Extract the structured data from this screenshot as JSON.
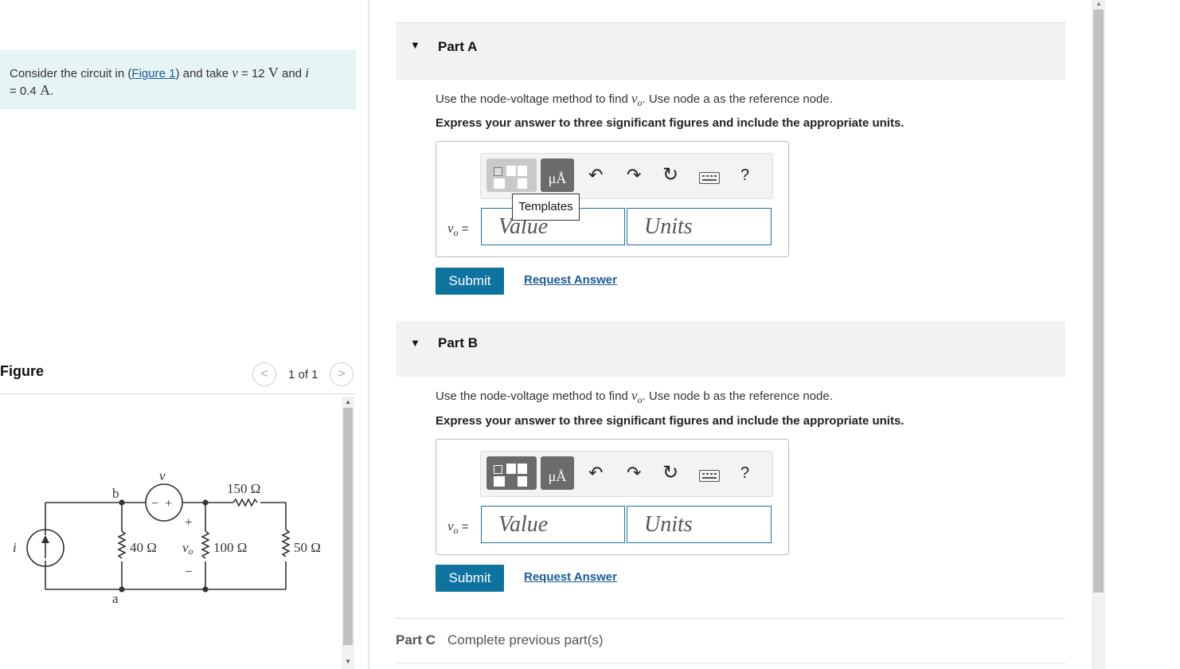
{
  "problem": {
    "prefix": "Consider the circuit in (",
    "figure_link": "Figure 1",
    "mid1": ") and take ",
    "v_sym": "v",
    "eq1": " = 12 ",
    "v_unit": "V",
    "and": " and ",
    "i_sym": "i",
    "eq2": "= 0.4 ",
    "i_unit": "A",
    "end": "."
  },
  "figure": {
    "title": "Figure",
    "prev": "<",
    "counter": "1 of 1",
    "next": ">",
    "circuit": {
      "labels": {
        "b": "b",
        "a": "a",
        "v": "v",
        "i": "i",
        "r40": "40 Ω",
        "r100": "100 Ω",
        "r150": "150 Ω",
        "r50": "50 Ω",
        "vo": "v",
        "vo_sub": "o",
        "plus": "+",
        "minus": "−",
        "src_minus": "−",
        "src_plus": "+"
      }
    }
  },
  "partA": {
    "label": "Part A",
    "question_pre": "Use the node-voltage method to find ",
    "question_var": "v",
    "question_sub": "o",
    "question_post": ". Use node a as the reference node.",
    "instruction": "Express your answer to three significant figures and include the appropriate units.",
    "var_label": "v",
    "var_sub": "o",
    "eq": " =",
    "value_placeholder": "Value",
    "units_placeholder": "Units",
    "tooltip": "Templates",
    "submit": "Submit",
    "request": "Request Answer"
  },
  "partB": {
    "label": "Part B",
    "question_pre": "Use the node-voltage method to find ",
    "question_var": "v",
    "question_sub": "o",
    "question_post": ". Use node b as the reference node.",
    "instruction": "Express your answer to three significant figures and include the appropriate units.",
    "var_label": "v",
    "var_sub": "o",
    "eq": " =",
    "value_placeholder": "Value",
    "units_placeholder": "Units",
    "submit": "Submit",
    "request": "Request Answer"
  },
  "partC": {
    "label": "Part C",
    "status": "Complete previous part(s)"
  },
  "toolbar": {
    "mu_label": "μÅ",
    "undo": "↶",
    "redo": "↷",
    "reset": "↻",
    "help": "?"
  }
}
